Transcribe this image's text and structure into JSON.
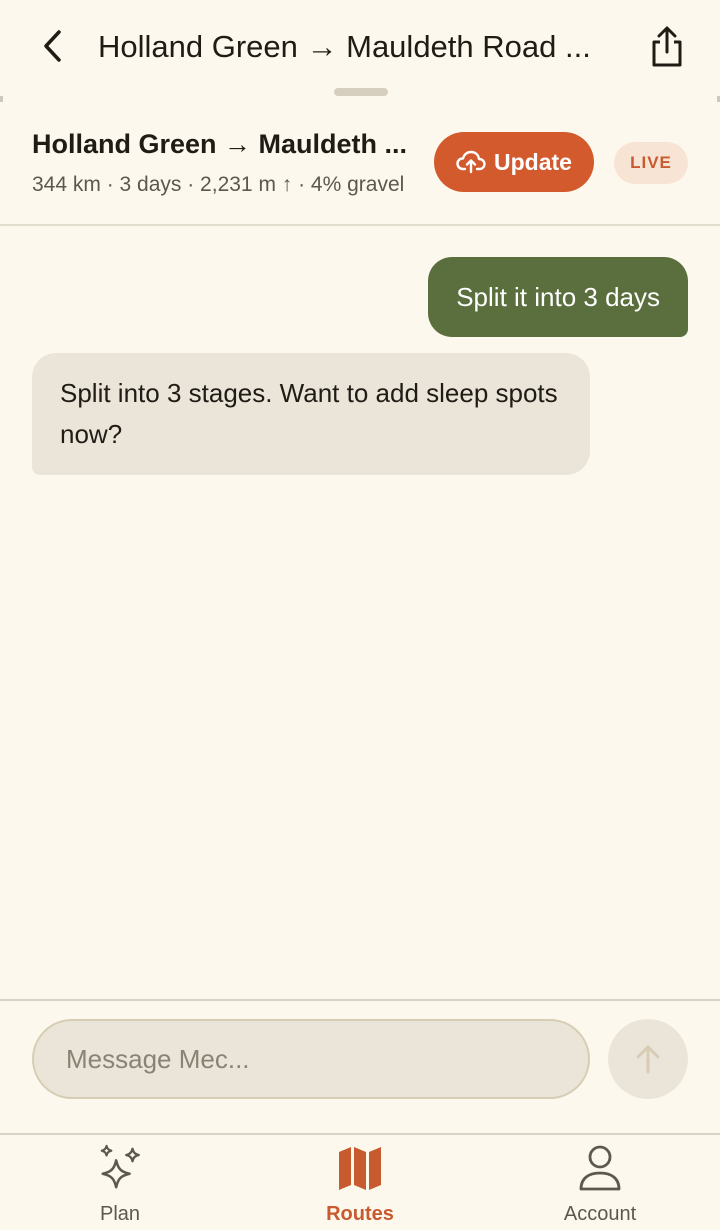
{
  "colors": {
    "accent": "#d35a2c",
    "user_bubble": "#5b6f3e",
    "bot_bubble": "#ebe5d9",
    "background": "#fdf8ed"
  },
  "topbar": {
    "back_icon": "chevron-left-icon",
    "title": "Holland Green → Mauldeth Road ...",
    "share_icon": "share-icon"
  },
  "route": {
    "title": "Holland Green → Mauldeth ...",
    "stats": "344 km · 3 days · 2,231 m ↑ · 4% gravel",
    "update_label": "Update",
    "update_icon": "cloud-upload-icon",
    "live_label": "LIVE"
  },
  "chat": {
    "messages": [
      {
        "role": "user",
        "text": "Split it into 3 days"
      },
      {
        "role": "assistant",
        "text": "Split into 3 stages. Want to add sleep spots now?"
      }
    ]
  },
  "composer": {
    "placeholder": "Message Mec...",
    "value": "",
    "send_icon": "arrow-up-icon"
  },
  "tabs": [
    {
      "label": "Plan",
      "icon": "sparkles-icon",
      "active": false
    },
    {
      "label": "Routes",
      "icon": "map-icon",
      "active": true
    },
    {
      "label": "Account",
      "icon": "user-icon",
      "active": false
    }
  ]
}
